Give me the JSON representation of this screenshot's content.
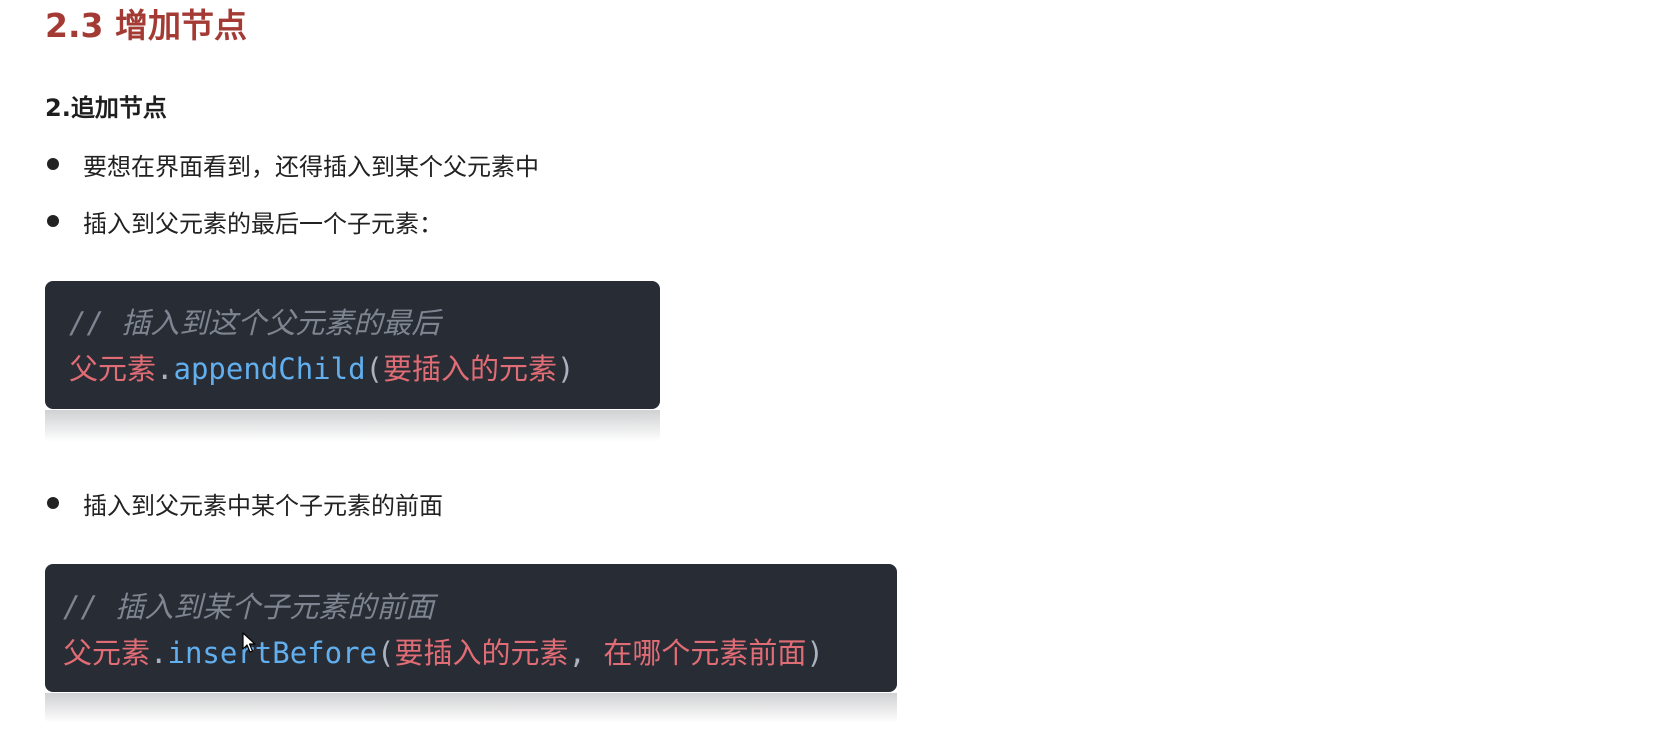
{
  "heading": "2.3 增加节点",
  "subheading": "2.追加节点",
  "bullets": [
    "要想在界面看到，还得插入到某个父元素中",
    "插入到父元素的最后一个子元素：",
    "插入到父元素中某个子元素的前面"
  ],
  "code1": {
    "comment": "// 插入到这个父元素的最后",
    "obj": "父元素",
    "dot": ".",
    "method": "appendChild",
    "open": "(",
    "arg1": "要插入的元素",
    "close": ")"
  },
  "code2": {
    "comment": "// 插入到某个子元素的前面",
    "obj": "父元素",
    "dot": ".",
    "method": "insertBefore",
    "open": "(",
    "arg1": "要插入的元素",
    "sep": ", ",
    "arg2": "在哪个元素前面",
    "close": ")"
  },
  "colors": {
    "heading": "#a33a33",
    "code_bg": "#282c34",
    "code_comment": "#7e8591",
    "code_string": "#e06c75",
    "code_method": "#61afef"
  }
}
